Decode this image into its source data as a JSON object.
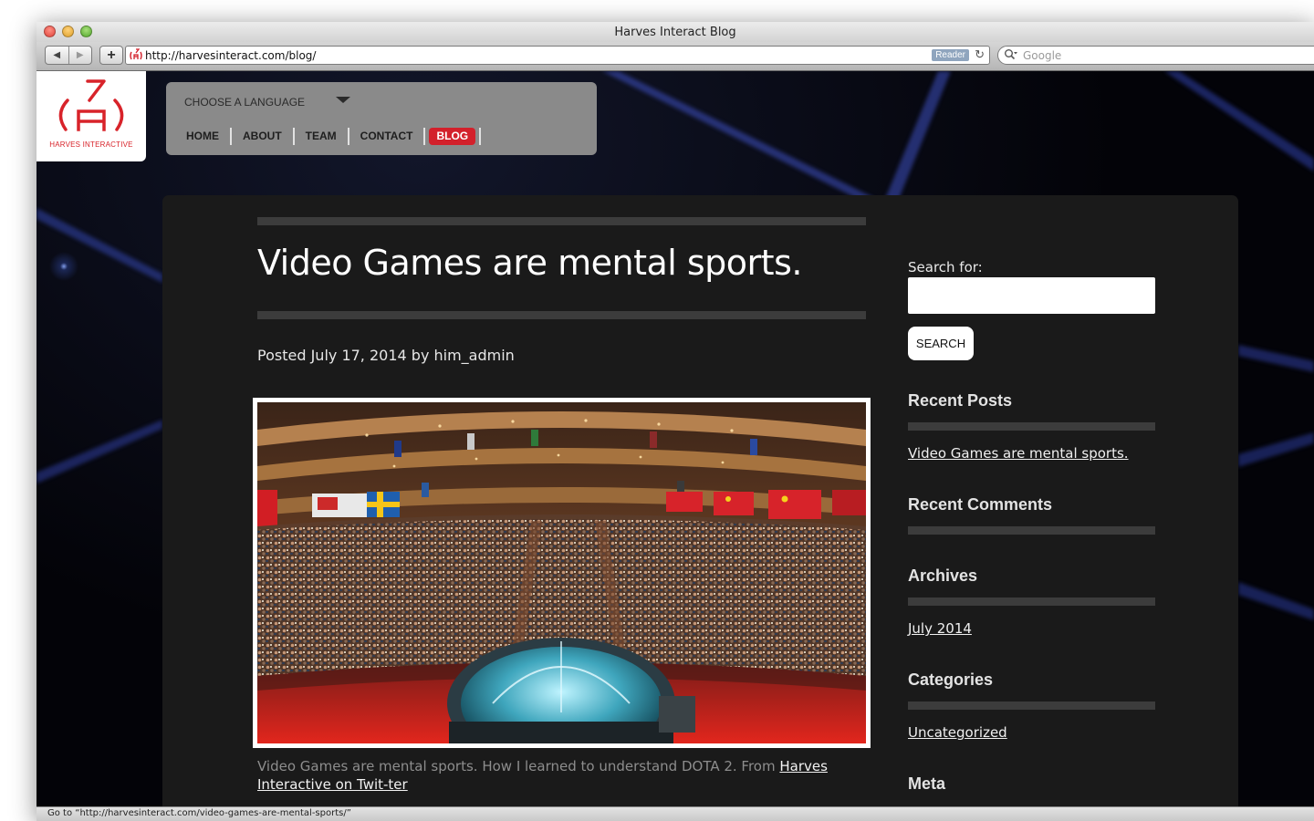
{
  "browser": {
    "window_title": "Harves Interact Blog",
    "url": "http://harvesinteract.com/blog/",
    "reader_label": "Reader",
    "search_placeholder": "Google",
    "status_text": "Go to “http://harvesinteract.com/video-games-are-mental-sports/”"
  },
  "site": {
    "logo_text": "HARVES INTERACTIVE",
    "language_label": "CHOOSE A LANGUAGE",
    "menu": [
      "HOME",
      "ABOUT",
      "TEAM",
      "CONTACT",
      "BLOG"
    ],
    "active_menu": "BLOG"
  },
  "post": {
    "title": "Video Games are mental sports.",
    "meta_prefix": "Posted",
    "date": "July 17, 2014",
    "meta_by": "by",
    "author": "him_admin",
    "caption_text": "Video Games are mental sports. How I learned to understand DOTA 2. From ",
    "caption_link": "Harves Interactive on Twit-ter"
  },
  "sidebar": {
    "search_label": "Search for:",
    "search_value": "",
    "search_button": "SEARCH",
    "recent_posts_title": "Recent Posts",
    "recent_posts": [
      "Video Games are mental sports."
    ],
    "recent_comments_title": "Recent Comments",
    "archives_title": "Archives",
    "archives": [
      "July 2014"
    ],
    "categories_title": "Categories",
    "categories": [
      "Uncategorized"
    ],
    "meta_title": "Meta"
  },
  "colors": {
    "brand_red": "#d3202b",
    "page_bg": "#000000",
    "panel_bg": "#1a1a1a",
    "nav_panel": "#8a8a8a"
  }
}
